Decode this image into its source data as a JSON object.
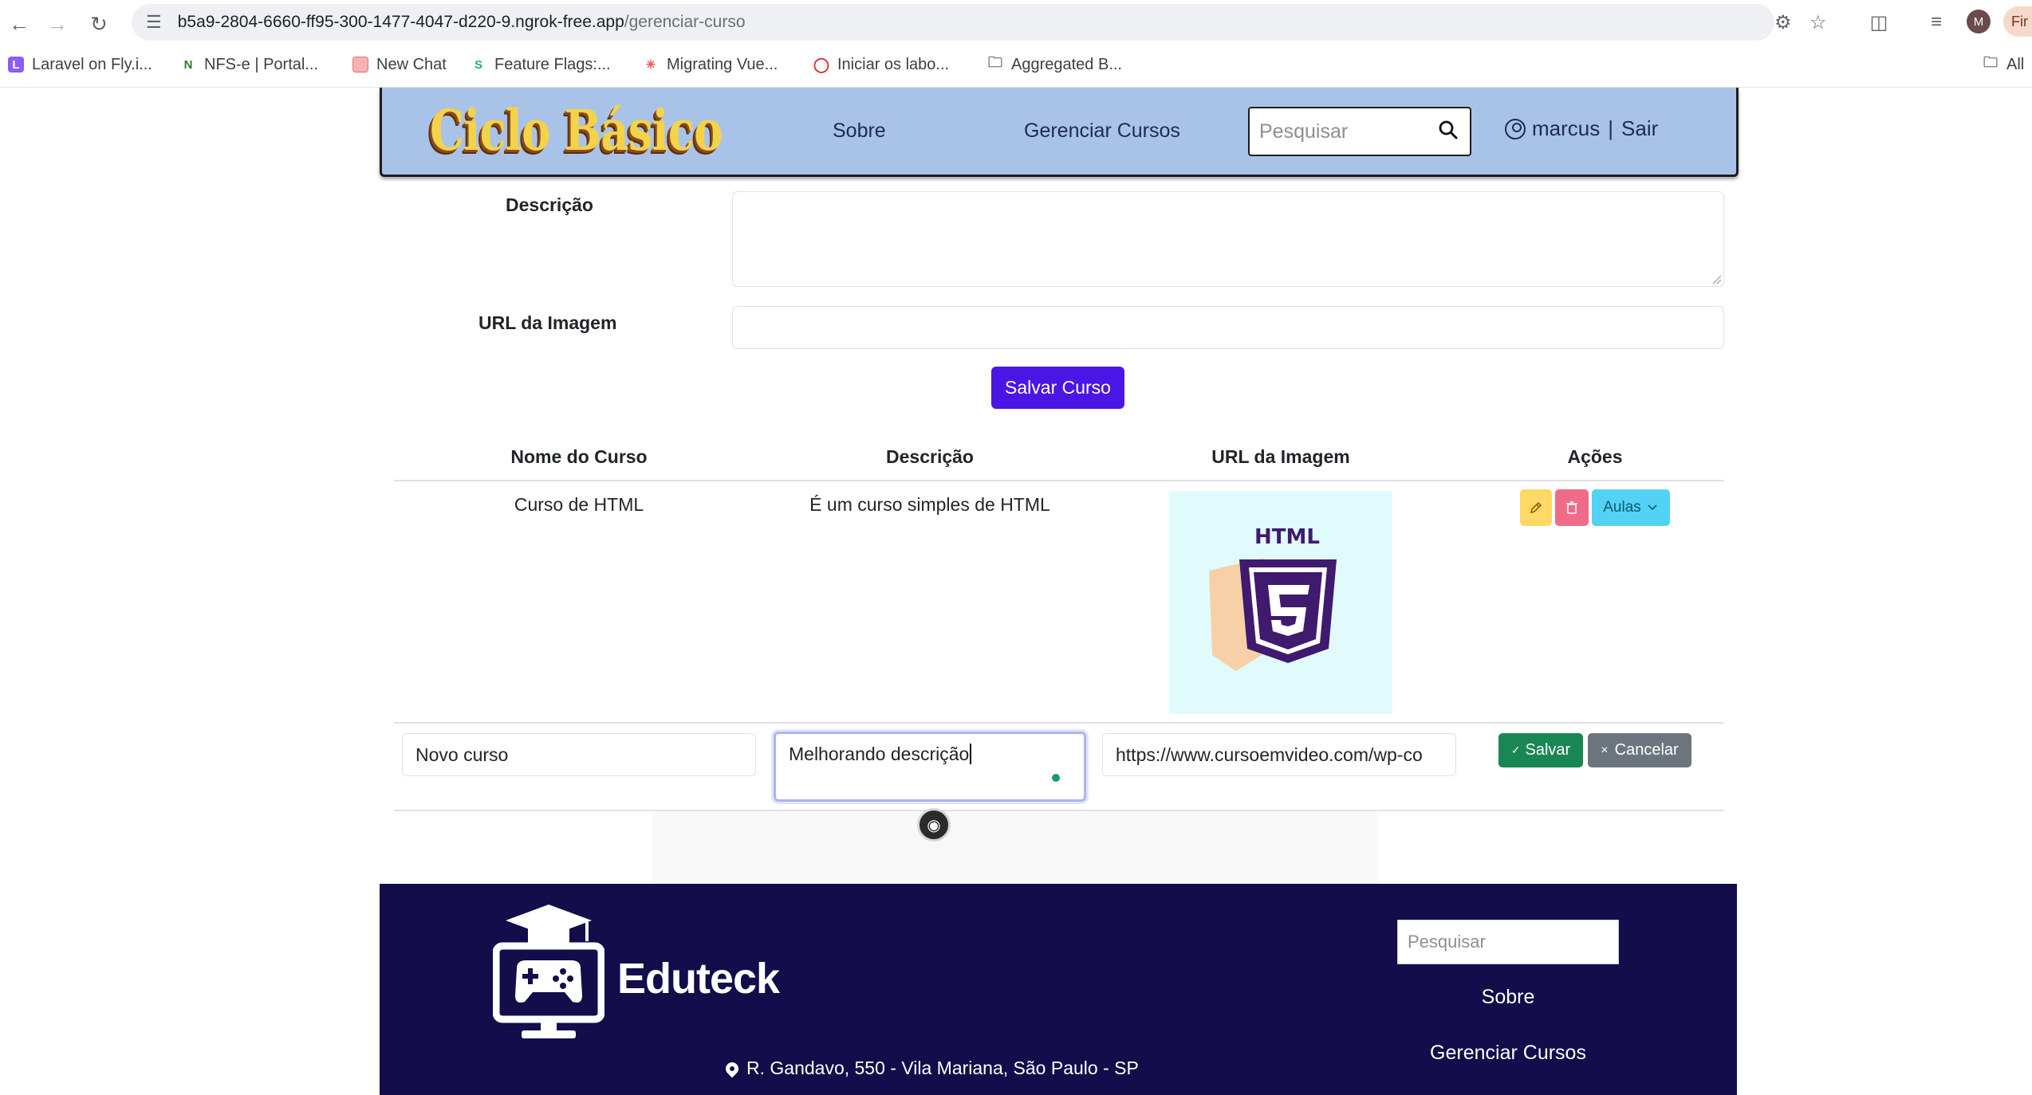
{
  "browser": {
    "url_host": "b5a9-2804-6660-ff95-300-1477-4047-d220-9.ngrok-free.app",
    "url_path": "/gerenciar-curso",
    "profile_initial": "M",
    "right_button_label": "Fir",
    "bookmarks": [
      {
        "label": "Laravel on Fly.i...",
        "icon": "laravel-icon",
        "color": "#8b5cf6"
      },
      {
        "label": "NFS-e | Portal...",
        "icon": "nfse-icon",
        "color": "#2e7d32"
      },
      {
        "label": "New Chat",
        "icon": "chat-icon",
        "color": "#e57373"
      },
      {
        "label": "Feature Flags:...",
        "icon": "flags-icon",
        "color": "#26a69a"
      },
      {
        "label": "Migrating Vue...",
        "icon": "vue-icon",
        "color": "#ef5350"
      },
      {
        "label": "Iniciar os labo...",
        "icon": "lab-icon",
        "color": "#d32f2f"
      },
      {
        "label": "Aggregated B...",
        "icon": "folder-icon",
        "color": "#5f6368"
      }
    ],
    "all_bookmarks_label": "All"
  },
  "header": {
    "logo_text": "Ciclo Básico",
    "nav": {
      "about": "Sobre",
      "manage": "Gerenciar Cursos"
    },
    "search_placeholder": "Pesquisar",
    "username": "marcus",
    "separator": "|",
    "logout": "Sair"
  },
  "form": {
    "description_label": "Descrição",
    "image_url_label": "URL da Imagem",
    "save_button": "Salvar Curso"
  },
  "table": {
    "headers": [
      "Nome do Curso",
      "Descrição",
      "URL da Imagem",
      "Ações"
    ],
    "rows": [
      {
        "name": "Curso de HTML",
        "description": "É um curso simples de HTML",
        "image_caption": "HTML"
      }
    ],
    "actions": {
      "lessons": "Aulas"
    },
    "edit_row": {
      "name_value": "Novo curso",
      "description_value": "Melhorando descrição",
      "url_value": "https://www.cursoemvideo.com/wp-co",
      "save": "Salvar",
      "cancel": "Cancelar"
    }
  },
  "footer": {
    "brand": "Eduteck",
    "address": "R. Gandavo, 550 - Vila Mariana, São Paulo - SP",
    "search_placeholder": "Pesquisar",
    "links": {
      "about": "Sobre",
      "manage": "Gerenciar Cursos"
    }
  },
  "colors": {
    "header_bg": "#a9c3e8",
    "primary_button": "#4a16e6",
    "success": "#198754",
    "secondary": "#6c757d",
    "warning": "#ffd966",
    "danger": "#f06b8a",
    "info": "#52d3f5",
    "footer_bg": "#130d4b",
    "html5_purple": "#3f1a6e"
  }
}
